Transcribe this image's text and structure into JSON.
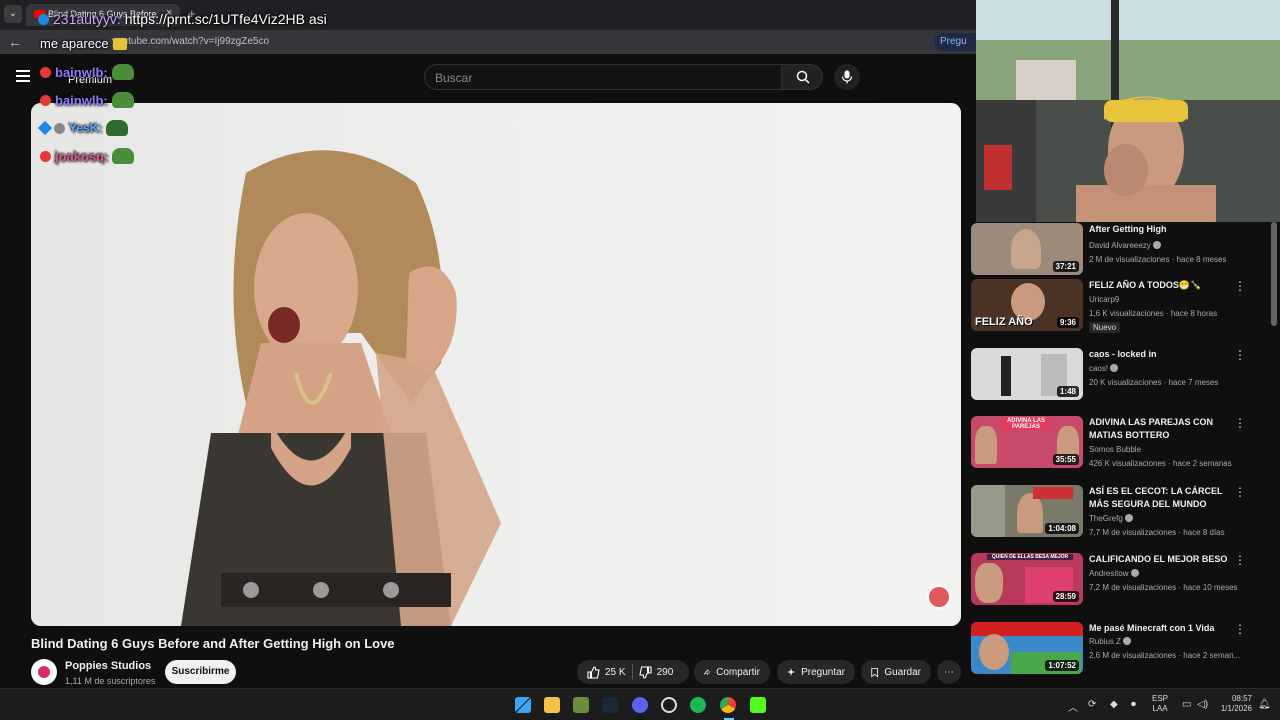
{
  "browser": {
    "tab_title": "Blind Dating 6 Guys Before and...",
    "tab_close": "×",
    "new_tab": "+",
    "url": "youtube.com/watch?v=Ij99zgZe5co",
    "ask_chip": "Pregu"
  },
  "header": {
    "premium_label": "Premium",
    "search_placeholder": "Buscar"
  },
  "chat": {
    "lines": [
      {
        "user": "231autyyv:",
        "message": "https://prnt.sc/1UTfe4Viz2HB asi"
      },
      {
        "user": "",
        "message": "me aparece"
      },
      {
        "user": "bainwlb:",
        "message": ""
      },
      {
        "user": "bainwlb:",
        "message": ""
      },
      {
        "user": "YesK:",
        "message": ""
      },
      {
        "user": "joakosq:",
        "message": ""
      }
    ]
  },
  "video": {
    "title": "Blind Dating 6 Guys Before and After Getting High on Love",
    "channel": "Poppies Studios",
    "subscribers": "1,11 M de suscriptores",
    "subscribe_label": "Suscribirme",
    "likes": "25 K",
    "dislikes": "290",
    "share_label": "Compartir",
    "ask_label": "Preguntar",
    "save_label": "Guardar",
    "more_label": "⋯"
  },
  "sidebar": {
    "items": [
      {
        "title": "After Getting High",
        "channel": "David Alvareeezy",
        "verified": true,
        "meta": "2 M de visualizaciones · hace 8 meses",
        "duration": "37:21",
        "badge": "",
        "thumb_color": "#9c8a7a"
      },
      {
        "title": "FELIZ AÑO A TODOS😁🍾",
        "channel": "Uricarp9",
        "verified": false,
        "meta": "1,6 K visualizaciones · hace 8 horas",
        "duration": "9:36",
        "badge": "Nuevo",
        "thumb_color": "#5a3b2a",
        "thumb_text": "FELIZ AÑO"
      },
      {
        "title": "caos - locked in",
        "channel": "caos!",
        "verified": true,
        "meta": "20 K visualizaciones · hace 7 meses",
        "duration": "1:48",
        "badge": "",
        "thumb_color": "#d8d8d8"
      },
      {
        "title": "ADIVINA LAS PAREJAS CON MATIAS BOTTERO",
        "channel": "Somos Bubble",
        "verified": false,
        "meta": "426 K visualizaciones · hace 2 semanas",
        "duration": "35:55",
        "badge": "",
        "thumb_color": "#c84a6a",
        "thumb_text": "ADIVINA LAS PAREJAS"
      },
      {
        "title": "ASÍ ES EL CECOT: LA CÁRCEL MÁS SEGURA DEL MUNDO",
        "channel": "TheGrefg",
        "verified": true,
        "meta": "7,7 M de visualizaciones · hace 8 días",
        "duration": "1:04:08",
        "badge": "",
        "thumb_color": "#7a7a6a"
      },
      {
        "title": "CALIFICANDO EL MEJOR BESO",
        "channel": "Andresitow",
        "verified": true,
        "meta": "7,2 M de visualizaciones · hace 10 meses",
        "duration": "28:59",
        "badge": "",
        "thumb_color": "#b83a5a",
        "thumb_text": "QUIEN DE ELLAS BESA MEJOR"
      },
      {
        "title": "Me pasé Minecraft con 1 Vida",
        "channel": "Rubius Z",
        "verified": true,
        "meta": "2,6 M de visualizaciones · hace 2 seman...",
        "duration": "1:07:52",
        "badge": "",
        "thumb_color": "#3a8acb"
      }
    ]
  },
  "taskbar": {
    "lang_line1": "ESP",
    "lang_line2": "LAA",
    "time": "08:57",
    "date": "1/1/2026"
  },
  "colors": {
    "accent_red": "#ff0000",
    "background": "#0f0f0f",
    "pill_bg": "#272727"
  }
}
